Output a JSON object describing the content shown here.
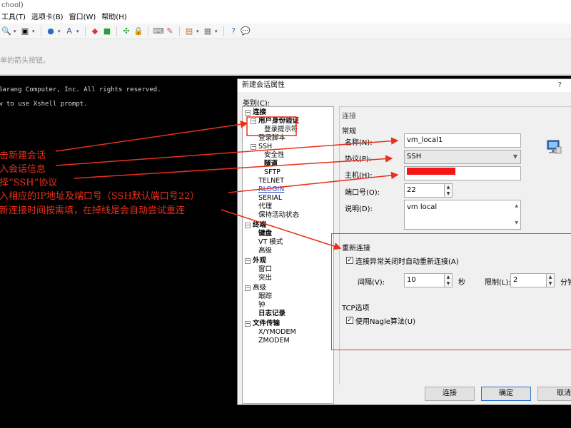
{
  "window": {
    "title": "chool)"
  },
  "menu": [
    "工具(T)",
    "选项卡(B)",
    "窗口(W)",
    "帮助(H)"
  ],
  "hint": {
    "text": "单的箭头按钮。"
  },
  "terminal": {
    "lines": [
      "Sarang Computer, Inc. All rights reserved.",
      "w to use Xshell prompt."
    ]
  },
  "annotations": [
    "击新建会话",
    "入会话信息",
    "择“SSH”协议",
    "入相应的IP地址及端口号（SSH默认端口号22）",
    "新连接时间按需填，在掉线是会自动尝试重连"
  ],
  "dialog": {
    "title": "新建会话属性",
    "help": "?",
    "category_label": "类别(C):",
    "tree": {
      "connection": "连接",
      "user_auth": "用户身份验证",
      "login_prompt": "登录提示符",
      "login_script": "登录脚本",
      "ssh": "SSH",
      "security": "安全性",
      "tunnel": "隧道",
      "sftp": "SFTP",
      "telnet": "TELNET",
      "rlogin": "RLOGIN",
      "serial": "SERIAL",
      "proxy": "代理",
      "keepalive": "保持活动状态",
      "terminal": "终端",
      "keyboard": "键盘",
      "vt_mode": "VT 模式",
      "advanced": "高级",
      "appearance": "外观",
      "window": "窗口",
      "highlight": "突出",
      "advanced2": "高级",
      "trace": "跟踪",
      "bell": "钟",
      "logging": "日志记录",
      "file_transfer": "文件传输",
      "xymodem": "X/YMODEM",
      "zmodem": "ZMODEM"
    },
    "pane_header": "连接",
    "general_group": "常规",
    "name_label": "名称(N):",
    "name_value": "vm_local1",
    "protocol_label": "协议(P):",
    "protocol_value": "SSH",
    "host_label": "主机(H):",
    "port_label": "端口号(O):",
    "port_value": "22",
    "desc_label": "说明(D):",
    "desc_value": "vm local",
    "reconnect_group": "重新连接",
    "reconnect_check_label": "连接异常关闭时自动重新连接(A)",
    "interval_label": "间隔(V):",
    "interval_value": "10",
    "interval_unit": "秒",
    "limit_label": "限制(L):",
    "limit_value": "2",
    "limit_unit": "分钟",
    "tcp_group": "TCP选项",
    "nagle_label": "使用Nagle算法(U)",
    "buttons": {
      "connect": "连接",
      "ok": "确定",
      "cancel": "取消"
    }
  },
  "colors": {
    "annotation": "#e8301c",
    "terminal_bg": "#000000",
    "redaction": "#f51515"
  }
}
